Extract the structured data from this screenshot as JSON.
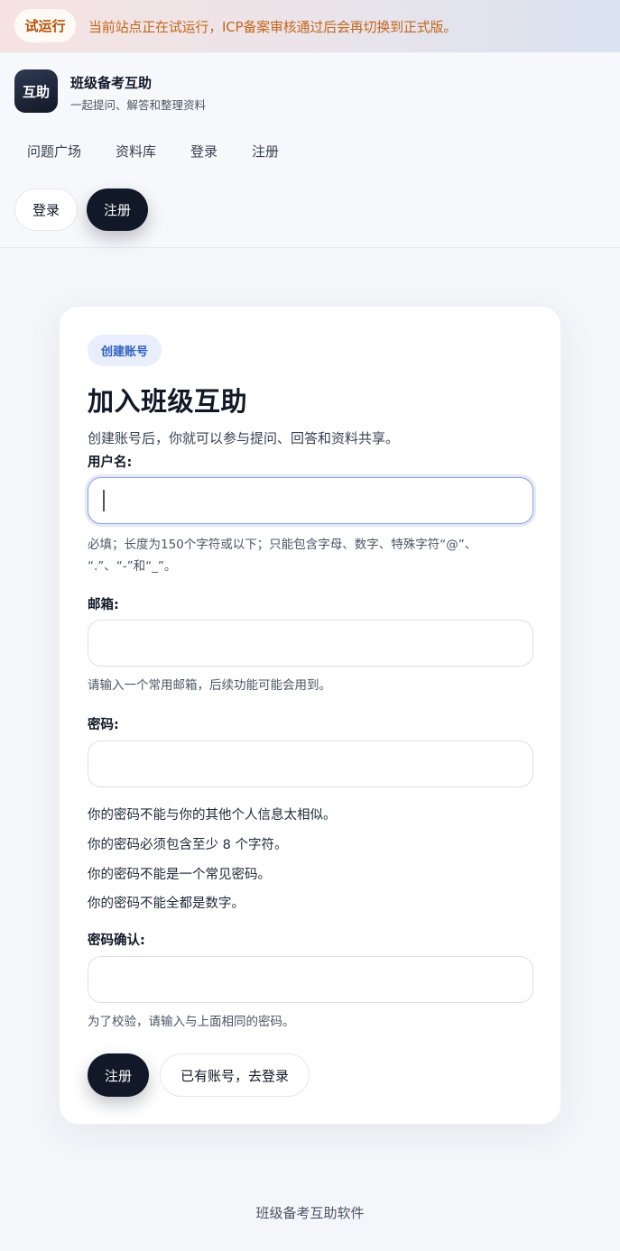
{
  "banner": {
    "badge": "试运行",
    "text": "当前站点正在试运行，ICP备案审核通过后会再切换到正式版。"
  },
  "header": {
    "logo_text": "互助",
    "site_title": "班级备考互助",
    "site_subtitle": "一起提问、解答和整理资料",
    "nav": [
      "问题广场",
      "资料库",
      "登录",
      "注册"
    ],
    "login_button": "登录",
    "register_button": "注册"
  },
  "card": {
    "tag": "创建账号",
    "title": "加入班级互助",
    "description": "创建账号后，你就可以参与提问、回答和资料共享。",
    "username": {
      "label": "用户名:",
      "value": "",
      "help_line1": "必填；长度为150个字符或以下；只能包含字母、数字、特殊字符“@”、",
      "help_line2": "“.”、“-”和“_”。"
    },
    "email": {
      "label": "邮箱:",
      "value": "",
      "help": "请输入一个常用邮箱，后续功能可能会用到。"
    },
    "password": {
      "label": "密码:",
      "value": "",
      "rules": [
        "你的密码不能与你的其他个人信息太相似。",
        "你的密码必须包含至少 8 个字符。",
        "你的密码不能是一个常见密码。",
        "你的密码不能全都是数字。"
      ]
    },
    "password_confirm": {
      "label": "密码确认:",
      "value": "",
      "help": "为了校验，请输入与上面相同的密码。"
    },
    "submit_button": "注册",
    "login_link_button": "已有账号，去登录"
  },
  "footer": "班级备考互助软件",
  "colors": {
    "primary_dark": "#111827",
    "tag_bg": "#e8eefb",
    "tag_text": "#2f5fc4",
    "banner_text": "#c2671b"
  }
}
